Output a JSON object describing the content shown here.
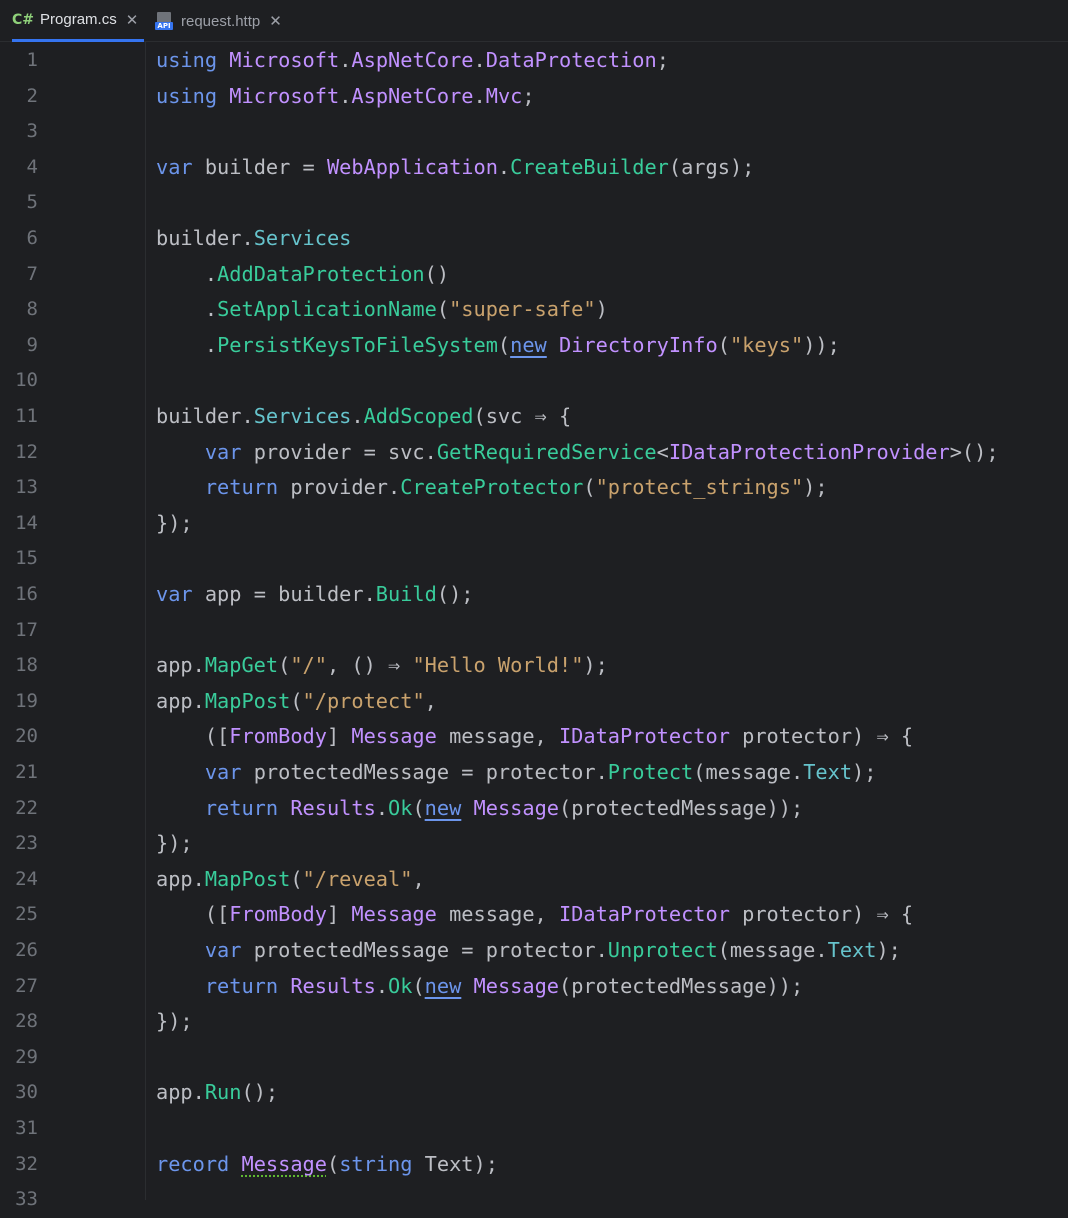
{
  "tabs": [
    {
      "icon": "csharp-file-icon",
      "icon_text": "C#",
      "label": "Program.cs",
      "active": true
    },
    {
      "icon": "http-request-file-icon",
      "icon_text": "API",
      "label": "request.http",
      "active": false
    }
  ],
  "close_glyph": "✕",
  "colors": {
    "background": "#1e1f22",
    "keyword": "#6c95eb",
    "type": "#c191ff",
    "method": "#39cc9b",
    "property": "#66c3cc",
    "string": "#c9a26d",
    "plain": "#bcbec4",
    "line_number": "#6f737a",
    "active_tab_underline": "#3574f0"
  },
  "editor": {
    "line_numbers": [
      "1",
      "2",
      "3",
      "4",
      "5",
      "6",
      "7",
      "8",
      "9",
      "10",
      "11",
      "12",
      "13",
      "14",
      "15",
      "16",
      "17",
      "18",
      "19",
      "20",
      "21",
      "22",
      "23",
      "24",
      "25",
      "26",
      "27",
      "28",
      "29",
      "30",
      "31",
      "32",
      "33"
    ],
    "lines": [
      [
        {
          "t": "kw",
          "v": "using"
        },
        {
          "t": "plain",
          "v": " "
        },
        {
          "t": "type",
          "v": "Microsoft"
        },
        {
          "t": "plain",
          "v": "."
        },
        {
          "t": "type",
          "v": "AspNetCore"
        },
        {
          "t": "plain",
          "v": "."
        },
        {
          "t": "type",
          "v": "DataProtection"
        },
        {
          "t": "plain",
          "v": ";"
        }
      ],
      [
        {
          "t": "kw",
          "v": "using"
        },
        {
          "t": "plain",
          "v": " "
        },
        {
          "t": "type",
          "v": "Microsoft"
        },
        {
          "t": "plain",
          "v": "."
        },
        {
          "t": "type",
          "v": "AspNetCore"
        },
        {
          "t": "plain",
          "v": "."
        },
        {
          "t": "type",
          "v": "Mvc"
        },
        {
          "t": "plain",
          "v": ";"
        }
      ],
      [],
      [
        {
          "t": "kw",
          "v": "var"
        },
        {
          "t": "plain",
          "v": " builder = "
        },
        {
          "t": "type",
          "v": "WebApplication"
        },
        {
          "t": "plain",
          "v": "."
        },
        {
          "t": "meth",
          "v": "CreateBuilder"
        },
        {
          "t": "plain",
          "v": "(args);"
        }
      ],
      [],
      [
        {
          "t": "plain",
          "v": "builder."
        },
        {
          "t": "prop",
          "v": "Services"
        }
      ],
      [
        {
          "t": "plain",
          "v": "    ."
        },
        {
          "t": "meth",
          "v": "AddDataProtection"
        },
        {
          "t": "plain",
          "v": "()"
        }
      ],
      [
        {
          "t": "plain",
          "v": "    ."
        },
        {
          "t": "meth",
          "v": "SetApplicationName"
        },
        {
          "t": "plain",
          "v": "("
        },
        {
          "t": "str",
          "v": "\"super-safe\""
        },
        {
          "t": "plain",
          "v": ")"
        }
      ],
      [
        {
          "t": "plain",
          "v": "    ."
        },
        {
          "t": "meth",
          "v": "PersistKeysToFileSystem"
        },
        {
          "t": "plain",
          "v": "("
        },
        {
          "t": "kwu",
          "v": "new"
        },
        {
          "t": "plain",
          "v": " "
        },
        {
          "t": "type",
          "v": "DirectoryInfo"
        },
        {
          "t": "plain",
          "v": "("
        },
        {
          "t": "str",
          "v": "\"keys\""
        },
        {
          "t": "plain",
          "v": "));"
        }
      ],
      [],
      [
        {
          "t": "plain",
          "v": "builder."
        },
        {
          "t": "prop",
          "v": "Services"
        },
        {
          "t": "plain",
          "v": "."
        },
        {
          "t": "meth",
          "v": "AddScoped"
        },
        {
          "t": "plain",
          "v": "(svc ⇒ {"
        }
      ],
      [
        {
          "t": "plain",
          "v": "    "
        },
        {
          "t": "kw",
          "v": "var"
        },
        {
          "t": "plain",
          "v": " provider = svc."
        },
        {
          "t": "meth",
          "v": "GetRequiredService"
        },
        {
          "t": "plain",
          "v": "<"
        },
        {
          "t": "type",
          "v": "IDataProtectionProvider"
        },
        {
          "t": "plain",
          "v": ">();"
        }
      ],
      [
        {
          "t": "plain",
          "v": "    "
        },
        {
          "t": "kw",
          "v": "return"
        },
        {
          "t": "plain",
          "v": " provider."
        },
        {
          "t": "meth",
          "v": "CreateProtector"
        },
        {
          "t": "plain",
          "v": "("
        },
        {
          "t": "str",
          "v": "\"protect_strings\""
        },
        {
          "t": "plain",
          "v": ");"
        }
      ],
      [
        {
          "t": "plain",
          "v": "});"
        }
      ],
      [],
      [
        {
          "t": "kw",
          "v": "var"
        },
        {
          "t": "plain",
          "v": " app = builder."
        },
        {
          "t": "meth",
          "v": "Build"
        },
        {
          "t": "plain",
          "v": "();"
        }
      ],
      [],
      [
        {
          "t": "plain",
          "v": "app."
        },
        {
          "t": "meth",
          "v": "MapGet"
        },
        {
          "t": "plain",
          "v": "("
        },
        {
          "t": "str",
          "v": "\"/\""
        },
        {
          "t": "plain",
          "v": ", () ⇒ "
        },
        {
          "t": "str",
          "v": "\"Hello World!\""
        },
        {
          "t": "plain",
          "v": ");"
        }
      ],
      [
        {
          "t": "plain",
          "v": "app."
        },
        {
          "t": "meth",
          "v": "MapPost"
        },
        {
          "t": "plain",
          "v": "("
        },
        {
          "t": "str",
          "v": "\"/protect\""
        },
        {
          "t": "plain",
          "v": ","
        }
      ],
      [
        {
          "t": "plain",
          "v": "    (["
        },
        {
          "t": "type",
          "v": "FromBody"
        },
        {
          "t": "plain",
          "v": "] "
        },
        {
          "t": "type",
          "v": "Message"
        },
        {
          "t": "plain",
          "v": " message, "
        },
        {
          "t": "type",
          "v": "IDataProtector"
        },
        {
          "t": "plain",
          "v": " protector) ⇒ {"
        }
      ],
      [
        {
          "t": "plain",
          "v": "    "
        },
        {
          "t": "kw",
          "v": "var"
        },
        {
          "t": "plain",
          "v": " protectedMessage = protector."
        },
        {
          "t": "meth",
          "v": "Protect"
        },
        {
          "t": "plain",
          "v": "(message."
        },
        {
          "t": "prop",
          "v": "Text"
        },
        {
          "t": "plain",
          "v": ");"
        }
      ],
      [
        {
          "t": "plain",
          "v": "    "
        },
        {
          "t": "kw",
          "v": "return"
        },
        {
          "t": "plain",
          "v": " "
        },
        {
          "t": "type",
          "v": "Results"
        },
        {
          "t": "plain",
          "v": "."
        },
        {
          "t": "meth",
          "v": "Ok"
        },
        {
          "t": "plain",
          "v": "("
        },
        {
          "t": "kwu",
          "v": "new"
        },
        {
          "t": "plain",
          "v": " "
        },
        {
          "t": "type",
          "v": "Message"
        },
        {
          "t": "plain",
          "v": "(protectedMessage));"
        }
      ],
      [
        {
          "t": "plain",
          "v": "});"
        }
      ],
      [
        {
          "t": "plain",
          "v": "app."
        },
        {
          "t": "meth",
          "v": "MapPost"
        },
        {
          "t": "plain",
          "v": "("
        },
        {
          "t": "str",
          "v": "\"/reveal\""
        },
        {
          "t": "plain",
          "v": ","
        }
      ],
      [
        {
          "t": "plain",
          "v": "    (["
        },
        {
          "t": "type",
          "v": "FromBody"
        },
        {
          "t": "plain",
          "v": "] "
        },
        {
          "t": "type",
          "v": "Message"
        },
        {
          "t": "plain",
          "v": " message, "
        },
        {
          "t": "type",
          "v": "IDataProtector"
        },
        {
          "t": "plain",
          "v": " protector) ⇒ {"
        }
      ],
      [
        {
          "t": "plain",
          "v": "    "
        },
        {
          "t": "kw",
          "v": "var"
        },
        {
          "t": "plain",
          "v": " protectedMessage = protector."
        },
        {
          "t": "meth",
          "v": "Unprotect"
        },
        {
          "t": "plain",
          "v": "(message."
        },
        {
          "t": "prop",
          "v": "Text"
        },
        {
          "t": "plain",
          "v": ");"
        }
      ],
      [
        {
          "t": "plain",
          "v": "    "
        },
        {
          "t": "kw",
          "v": "return"
        },
        {
          "t": "plain",
          "v": " "
        },
        {
          "t": "type",
          "v": "Results"
        },
        {
          "t": "plain",
          "v": "."
        },
        {
          "t": "meth",
          "v": "Ok"
        },
        {
          "t": "plain",
          "v": "("
        },
        {
          "t": "kwu",
          "v": "new"
        },
        {
          "t": "plain",
          "v": " "
        },
        {
          "t": "type",
          "v": "Message"
        },
        {
          "t": "plain",
          "v": "(protectedMessage));"
        }
      ],
      [
        {
          "t": "plain",
          "v": "});"
        }
      ],
      [],
      [
        {
          "t": "plain",
          "v": "app."
        },
        {
          "t": "meth",
          "v": "Run"
        },
        {
          "t": "plain",
          "v": "();"
        }
      ],
      [],
      [
        {
          "t": "kw",
          "v": "record"
        },
        {
          "t": "plain",
          "v": " "
        },
        {
          "t": "typew",
          "v": "Message"
        },
        {
          "t": "plain",
          "v": "("
        },
        {
          "t": "kw",
          "v": "string"
        },
        {
          "t": "plain",
          "v": " Text);"
        }
      ],
      []
    ]
  }
}
